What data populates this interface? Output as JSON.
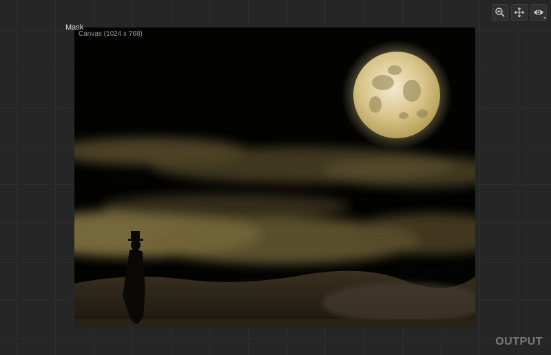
{
  "toolbar": {
    "icons": [
      "zoom-in-icon",
      "move-icon",
      "eye-icon"
    ]
  },
  "node": {
    "title": "Mask",
    "canvas_label": "Canvas (1024 x 768)",
    "footer_label": "OUTPUT"
  },
  "colors": {
    "background": "#262626",
    "moon": "#e8d9a0",
    "clouds": "#8a7a45"
  }
}
